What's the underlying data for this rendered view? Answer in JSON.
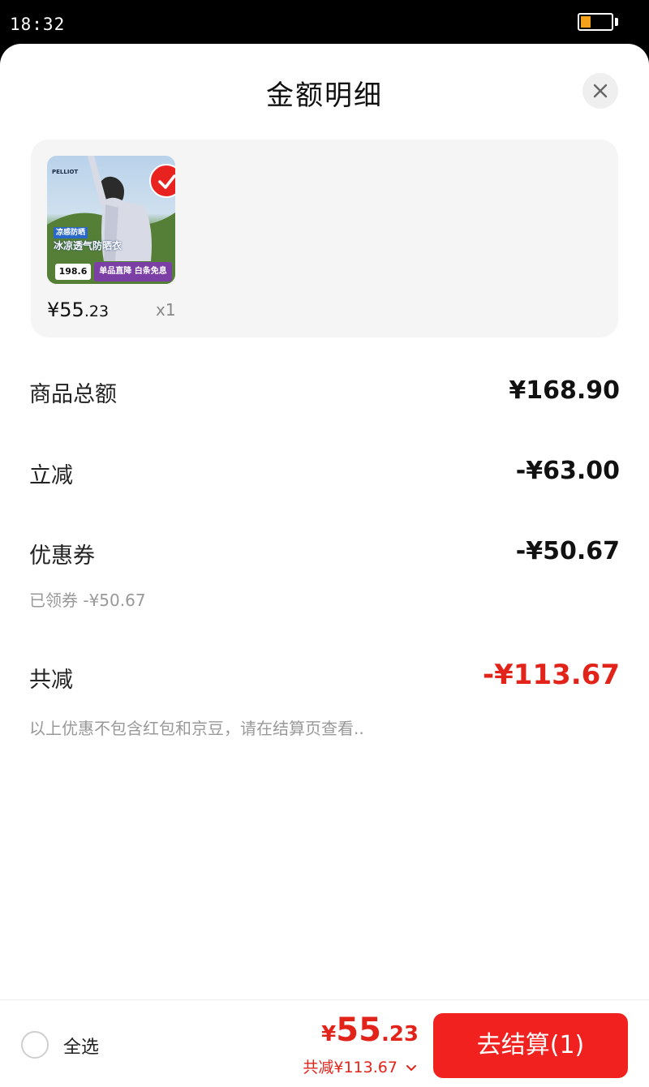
{
  "status_bar": {
    "time": "18:32"
  },
  "sheet": {
    "title": "金额明细"
  },
  "product": {
    "image_brand": "PELLIOT",
    "image_tag1": "凉感防晒",
    "image_tag2": "冰凉透气防晒衣",
    "image_price": "198.6",
    "image_promo": "单品直降 白条免息",
    "price_symbol": "¥",
    "price_int": "55",
    "price_dec": ".23",
    "quantity": "x1"
  },
  "breakdown": {
    "goods_total_label": "商品总额",
    "goods_total_value": "¥168.90",
    "instant_discount_label": "立减",
    "instant_discount_value": "-¥63.00",
    "coupon_label": "优惠券",
    "coupon_value": "-¥50.67",
    "coupon_note": "已领券 -¥50.67",
    "total_saving_label": "共减",
    "total_saving_value": "-¥113.67",
    "disclaimer": "以上优惠不包含红包和京豆，请在结算页查看.."
  },
  "bottom_bar": {
    "select_all_label": "全选",
    "price_symbol": "¥",
    "price_int": "55",
    "price_dec": ".23",
    "saving_text": "共减¥113.67",
    "checkout_label": "去结算(1)"
  },
  "colors": {
    "accent_red": "#e2231a",
    "checkout_red": "#f0211f",
    "battery": "#f3a21a"
  }
}
